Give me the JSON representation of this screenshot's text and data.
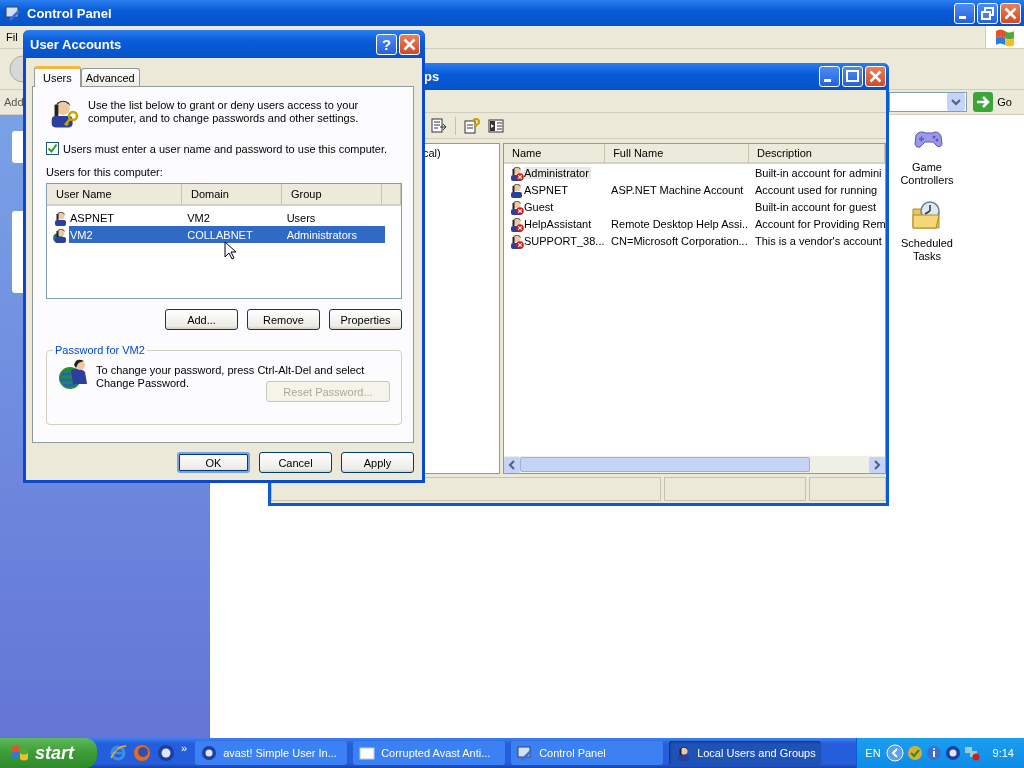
{
  "control_panel": {
    "title": "Control Panel",
    "menu_items": [
      "Fil"
    ],
    "address_label": "Add",
    "go": "Go",
    "items": [
      {
        "kind": "gamepad",
        "label": "Game Controllers"
      },
      {
        "kind": "tasks",
        "label": "Scheduled Tasks"
      }
    ]
  },
  "local_users_window": {
    "title": "ps",
    "tree_items": [
      "cal)"
    ],
    "columns": [
      "Name",
      "Full Name",
      "Description"
    ],
    "rows": [
      {
        "name": "Administrator",
        "description": "Built-in account for admini",
        "disabled": true,
        "selected": true
      },
      {
        "name": "ASPNET",
        "full_name": "ASP.NET Machine Account",
        "description": "Account used for running",
        "disabled": false,
        "selected": false
      },
      {
        "name": "Guest",
        "description": "Built-in account for guest",
        "disabled": true,
        "selected": false
      },
      {
        "name": "HelpAssistant",
        "full_name": "Remote Desktop Help Assi...",
        "description": "Account for Providing Rem",
        "disabled": true,
        "selected": false
      },
      {
        "name": "SUPPORT_38...",
        "full_name": "CN=Microsoft Corporation...",
        "description": "This is a vendor's account",
        "disabled": true,
        "selected": false
      }
    ]
  },
  "user_accounts": {
    "title": "User Accounts",
    "help": "?",
    "tabs": [
      {
        "label": "Users",
        "selected": true
      },
      {
        "label": "Advanced",
        "selected": false
      }
    ],
    "intro": "Use the list below to grant or deny users access to your computer, and to change passwords and other settings.",
    "require_password": {
      "label": "Users must enter a user name and password to use this computer.",
      "checked": true
    },
    "list_label": "Users for this computer:",
    "columns": [
      "User Name",
      "Domain",
      "Group"
    ],
    "rows": [
      {
        "kind": "local",
        "user_name": "ASPNET",
        "domain": "VM2",
        "group": "Users",
        "selected": false
      },
      {
        "kind": "domain",
        "user_name": "VM2",
        "domain": "COLLABNET",
        "group": "Administrators",
        "selected": true
      }
    ],
    "list_buttons": [
      "Add...",
      "Remove",
      "Properties"
    ],
    "password_group": {
      "title": "Password for VM2",
      "text": "To change your password, press Ctrl-Alt-Del and select Change Password.",
      "reset_button": {
        "label": "Reset Password...",
        "disabled": true
      }
    },
    "buttons": [
      {
        "label": "OK",
        "default": true
      },
      {
        "label": "Cancel",
        "default": false
      },
      {
        "label": "Apply",
        "default": false
      }
    ]
  },
  "taskbar": {
    "start": "start",
    "chevron": "»",
    "tasks": [
      {
        "label": "avast! Simple User In...",
        "kind": "avast",
        "selected": false
      },
      {
        "label": "Corrupted Avast Anti...",
        "kind": "blank",
        "selected": false
      },
      {
        "label": "Control Panel",
        "kind": "panel",
        "selected": false
      },
      {
        "label": "Local Users and Groups",
        "kind": "users",
        "selected": true
      }
    ],
    "language": "EN",
    "clock": "9:14"
  }
}
